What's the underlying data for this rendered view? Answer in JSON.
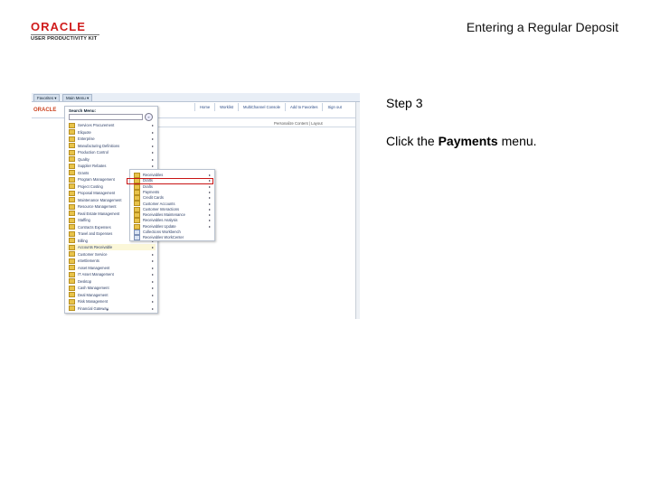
{
  "header": {
    "logo_top": "ORACLE",
    "logo_sub": "USER PRODUCTIVITY KIT",
    "document_title": "Entering a Regular Deposit"
  },
  "step": {
    "label": "Step 3",
    "instruction_prefix": "Click the ",
    "instruction_target": "Payments",
    "instruction_suffix": " menu."
  },
  "screenshot": {
    "tabs": [
      "Favorites ▾",
      "Main Menu ▾"
    ],
    "brand": "ORACLE",
    "nav_links": [
      "Home",
      "Worklist",
      "MultiChannel Console",
      "Add to Favorites",
      "Sign out"
    ],
    "personalize": "Personalize Content | Layout",
    "main_menu": {
      "title": "Search Menu:",
      "go": "»",
      "items": [
        {
          "label": "Services Procurement",
          "arrow": "▸"
        },
        {
          "label": "Eliquote",
          "arrow": "▸"
        },
        {
          "label": "Enterprise",
          "arrow": "▸"
        },
        {
          "label": "Manufacturing Definitions",
          "arrow": "▸"
        },
        {
          "label": "Production Control",
          "arrow": "▸"
        },
        {
          "label": "Quality",
          "arrow": "▸"
        },
        {
          "label": "Supplier Rebates",
          "arrow": "▸"
        },
        {
          "label": "Grants",
          "arrow": "▸"
        },
        {
          "label": "Program Management",
          "arrow": "▸"
        },
        {
          "label": "Project Costing",
          "arrow": "▸"
        },
        {
          "label": "Proposal Management",
          "arrow": "▸"
        },
        {
          "label": "Maintenance Management",
          "arrow": "▸"
        },
        {
          "label": "Resource Management",
          "arrow": "▸"
        },
        {
          "label": "Real Estate Management",
          "arrow": "▸"
        },
        {
          "label": "Staffing",
          "arrow": "▸"
        },
        {
          "label": "Contracts Expenses",
          "arrow": "▸"
        },
        {
          "label": "Travel and Expenses",
          "arrow": "▸"
        },
        {
          "label": "Billing",
          "arrow": "▸"
        },
        {
          "label": "Accounts Receivable",
          "arrow": "▸"
        },
        {
          "label": "Customer Service",
          "arrow": "▸"
        },
        {
          "label": "eSettlements",
          "arrow": "▸"
        },
        {
          "label": "Asset Management",
          "arrow": "▸"
        },
        {
          "label": "IT Asset Management",
          "arrow": "▸"
        },
        {
          "label": "Desktop",
          "arrow": "▸"
        },
        {
          "label": "Cash Management",
          "arrow": "▸"
        },
        {
          "label": "Deal Management",
          "arrow": "▸"
        },
        {
          "label": "Risk Management",
          "arrow": "▸"
        },
        {
          "label": "Financial Gateway",
          "arrow": "▸"
        }
      ],
      "bottom": "▾"
    },
    "sub_menu": {
      "items": [
        {
          "label": "Receivables",
          "arrow": "▸",
          "doc": false
        },
        {
          "label": "Drafts",
          "arrow": "▸",
          "doc": false
        },
        {
          "label": "Drafts",
          "arrow": "▸",
          "doc": false
        },
        {
          "label": "Payments",
          "arrow": "▸",
          "doc": false
        },
        {
          "label": "Credit Cards",
          "arrow": "▸",
          "doc": false
        },
        {
          "label": "Customer Accounts",
          "arrow": "▸",
          "doc": false
        },
        {
          "label": "Customer Interactions",
          "arrow": "▸",
          "doc": false
        },
        {
          "label": "Receivables Maintenance",
          "arrow": "▸",
          "doc": false
        },
        {
          "label": "Receivables Analysis",
          "arrow": "▸",
          "doc": false
        },
        {
          "label": "Receivables Update",
          "arrow": "▸",
          "doc": false
        },
        {
          "label": "Collections Workbench",
          "arrow": "",
          "doc": true
        },
        {
          "label": "Receivables WorkCenter",
          "arrow": "",
          "doc": true
        }
      ]
    }
  }
}
